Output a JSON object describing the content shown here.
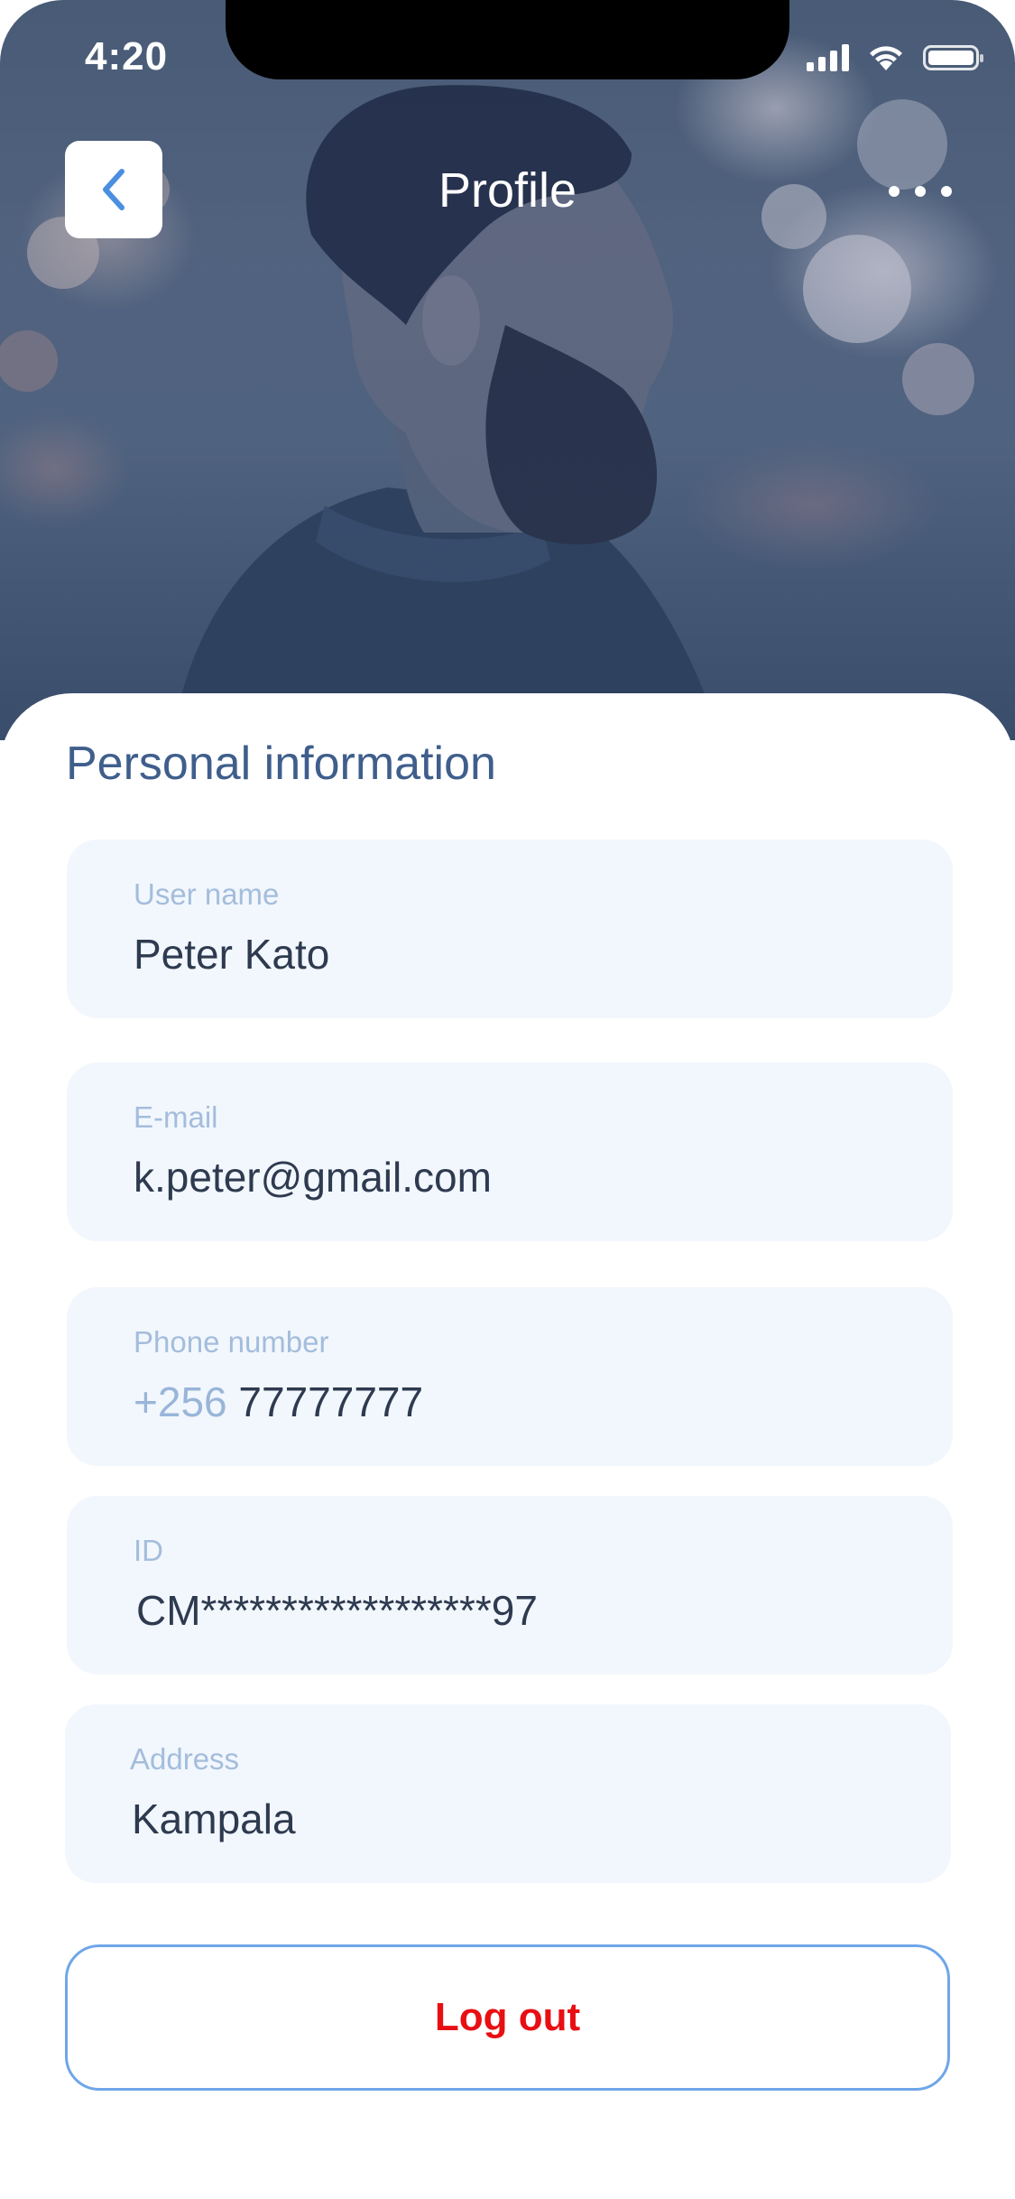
{
  "status_bar": {
    "time": "4:20",
    "signal_icon": "cellular-signal-icon",
    "wifi_icon": "wifi-icon",
    "battery_icon": "battery-icon"
  },
  "header": {
    "title": "Profile",
    "back_icon": "chevron-left-icon",
    "more_icon": "more-horizontal-icon"
  },
  "colors": {
    "accent": "#4a8fe0",
    "title_blue": "#3f5e8c",
    "label": "#a4bddc",
    "field_bg": "#f2f7fd",
    "logout_red": "#e80f13",
    "logout_border": "#6fa6e8"
  },
  "section": {
    "title": "Personal information"
  },
  "fields": {
    "username": {
      "label": "User name",
      "value": "Peter Kato"
    },
    "email": {
      "label": "E-mail",
      "value": "k.peter@gmail.com"
    },
    "phone": {
      "label": "Phone number",
      "prefix": "+256",
      "value": "77777777"
    },
    "id": {
      "label": "ID",
      "value": "CM******************97"
    },
    "address": {
      "label": "Address",
      "value": "Kampala"
    }
  },
  "actions": {
    "logout_label": "Log out"
  }
}
